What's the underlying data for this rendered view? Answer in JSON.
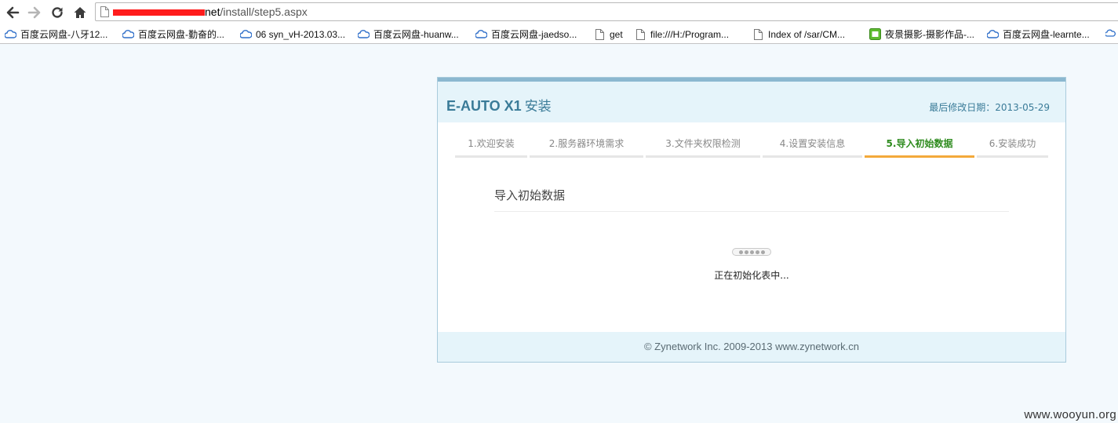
{
  "browser": {
    "url_host_suffix": "net",
    "url_path": "/install/step5.aspx",
    "bookmarks": [
      {
        "label": "百度云网盘-八牙12...",
        "icon": "baidu-cloud-icon"
      },
      {
        "label": "百度云网盘-勤奋的...",
        "icon": "baidu-cloud-icon"
      },
      {
        "label": "06 syn_vH-2013.03...",
        "icon": "baidu-cloud-icon"
      },
      {
        "label": "百度云网盘-huanw...",
        "icon": "baidu-cloud-icon"
      },
      {
        "label": "百度云网盘-jaedso...",
        "icon": "baidu-cloud-icon"
      },
      {
        "label": "get",
        "icon": "page-icon"
      },
      {
        "label": "file:///H:/Program...",
        "icon": "page-icon"
      },
      {
        "label": "Index of /sar/CM...",
        "icon": "page-icon"
      },
      {
        "label": "夜景摄影-摄影作品-...",
        "icon": "photo-site-icon"
      },
      {
        "label": "百度云网盘-learnte...",
        "icon": "baidu-cloud-icon"
      }
    ]
  },
  "installer": {
    "title_en": "E-AUTO X1",
    "title_cn": "安装",
    "last_modified": "最后修改日期：2013-05-29",
    "steps": [
      {
        "label": "1.欢迎安装",
        "active": false
      },
      {
        "label": "2.服务器环境需求",
        "active": false
      },
      {
        "label": "3.文件夹权限检测",
        "active": false
      },
      {
        "label": "4.设置安装信息",
        "active": false
      },
      {
        "label": "5.导入初始数据",
        "active": true
      },
      {
        "label": "6.安装成功",
        "active": false
      }
    ],
    "section_title": "导入初始数据",
    "status": "正在初始化表中...",
    "footer": "© Zynetwork Inc. 2009-2013 www.zynetwork.cn"
  },
  "watermark": "www.wooyun.org",
  "colors": {
    "accent": "#3a7b98",
    "active_step": "#2e8b1e",
    "active_underline": "#f3a93a",
    "panel_header_bg": "#e5f4fa",
    "redaction": "#ff1c1c"
  }
}
